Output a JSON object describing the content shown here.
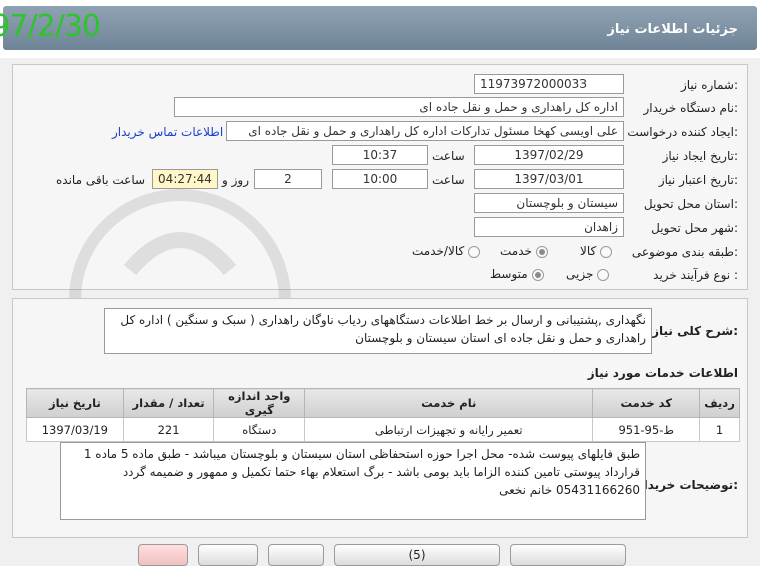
{
  "header": {
    "date": "97/2/30",
    "title": "جزئیات اطلاعات نیاز"
  },
  "form": {
    "need_number_label": "شماره نیاز:",
    "need_number": "1197397200003З",
    "buyer_org_label": "نام دستگاه خریدار:",
    "buyer_org": "اداره کل راهداری و حمل و نقل جاده ای",
    "requester_label": "ایجاد کننده درخواست:",
    "requester": "علی اویسی کهخا مسئول تدارکات اداره کل راهداری و حمل و نقل جاده ای",
    "contact_link": "اطلاعات تماس خریدار",
    "created_date_label": "تاریخ ایجاد نیاز:",
    "created_date": "1397/02/29",
    "time_label": "ساعت",
    "created_time": "10:37",
    "validity_label": "تاریخ اعتبار نیاز:",
    "validity_date": "1397/03/01",
    "validity_time": "10:00",
    "days_value": "2",
    "days_label": "روز و",
    "remaining_time": "04:27:44",
    "remaining_label": "ساعت باقی مانده",
    "province_label": "استان محل تحویل:",
    "province": "سیستان و بلوچستان",
    "city_label": "شهر محل تحویل:",
    "city": "زاهدان",
    "category_label": "طبقه بندی موضوعی:",
    "category_options": [
      "کالا",
      "خدمت",
      "کالا/خدمت"
    ],
    "category_selected": "خدمت",
    "purchase_type_label": "نوع فرآیند خرید :",
    "purchase_options": [
      "جزیی",
      "متوسط"
    ],
    "purchase_selected": "متوسط"
  },
  "description": {
    "label": "شرح کلی نیاز:",
    "text": "نگهداری ,پشتیبانی و ارسال بر خط اطلاعات دستگاههای ردیاب ناوگان راهداری ( سبک و سنگین ) اداره کل راهداری و حمل و نقل جاده ای استان سیستان و بلوچستان"
  },
  "services": {
    "title": "اطلاعات خدمات مورد نیاز",
    "columns": [
      "ردیف",
      "کد خدمت",
      "نام خدمت",
      "واحد اندازه گیری",
      "تعداد / مقدار",
      "تاریخ نیاز"
    ],
    "rows": [
      [
        "1",
        "ط-95-951",
        "تعمیر رایانه و تجهیزات ارتباطی",
        "دستگاه",
        "221",
        "1397/03/19"
      ]
    ]
  },
  "buyer_notes": {
    "label": "توضیحات خریدار:",
    "text": "طبق فایلهای پیوست شده- محل اجرا حوزه استحفاظی استان سیستان و بلوچستان میباشد - طبق ماده 5 ماده 1 قرارداد پیوستی تامین کننده الزاما باید بومی باشد - برگ استعلام بهاء حتما تکمیل و ممهور و ضمیمه گردد 05431166260 خانم نخعی"
  },
  "buttons": {
    "b1": "",
    "b2": "",
    "b3": "",
    "b4": "(5)",
    "b5": ""
  },
  "colors": {
    "date_green": "#2fc32f",
    "header_blue": "#7a8ea0",
    "label_link": "#1a3fcf"
  }
}
